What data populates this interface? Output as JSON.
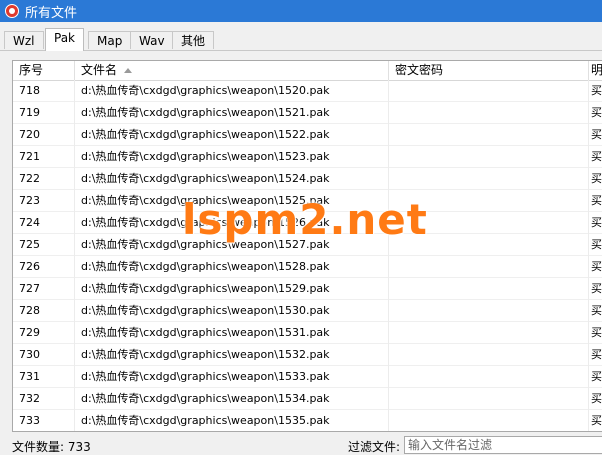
{
  "window": {
    "title": "所有文件",
    "icon": "app-icon"
  },
  "tabs": [
    {
      "label": "Wzl",
      "active": false
    },
    {
      "label": "Pak",
      "active": true
    },
    {
      "label": "Map",
      "active": false
    },
    {
      "label": "Wav",
      "active": false
    },
    {
      "label": "其他",
      "active": false
    }
  ],
  "table": {
    "columns": {
      "seq": "序号",
      "name": "文件名",
      "password": "密文密码",
      "extra": "明"
    },
    "sort": {
      "column": "name",
      "direction": "ascending",
      "icon": "sort-ascending-icon"
    },
    "rows": [
      {
        "seq": "718",
        "name": "d:\\热血传奇\\cxdgd\\graphics\\weapon\\1520.pak",
        "password": "",
        "extra": "买"
      },
      {
        "seq": "719",
        "name": "d:\\热血传奇\\cxdgd\\graphics\\weapon\\1521.pak",
        "password": "",
        "extra": "买"
      },
      {
        "seq": "720",
        "name": "d:\\热血传奇\\cxdgd\\graphics\\weapon\\1522.pak",
        "password": "",
        "extra": "买"
      },
      {
        "seq": "721",
        "name": "d:\\热血传奇\\cxdgd\\graphics\\weapon\\1523.pak",
        "password": "",
        "extra": "买"
      },
      {
        "seq": "722",
        "name": "d:\\热血传奇\\cxdgd\\graphics\\weapon\\1524.pak",
        "password": "",
        "extra": "买"
      },
      {
        "seq": "723",
        "name": "d:\\热血传奇\\cxdgd\\graphics\\weapon\\1525.pak",
        "password": "",
        "extra": "买"
      },
      {
        "seq": "724",
        "name": "d:\\热血传奇\\cxdgd\\graphics\\weapon\\1526.pak",
        "password": "",
        "extra": "买"
      },
      {
        "seq": "725",
        "name": "d:\\热血传奇\\cxdgd\\graphics\\weapon\\1527.pak",
        "password": "",
        "extra": "买"
      },
      {
        "seq": "726",
        "name": "d:\\热血传奇\\cxdgd\\graphics\\weapon\\1528.pak",
        "password": "",
        "extra": "买"
      },
      {
        "seq": "727",
        "name": "d:\\热血传奇\\cxdgd\\graphics\\weapon\\1529.pak",
        "password": "",
        "extra": "买"
      },
      {
        "seq": "728",
        "name": "d:\\热血传奇\\cxdgd\\graphics\\weapon\\1530.pak",
        "password": "",
        "extra": "买"
      },
      {
        "seq": "729",
        "name": "d:\\热血传奇\\cxdgd\\graphics\\weapon\\1531.pak",
        "password": "",
        "extra": "买"
      },
      {
        "seq": "730",
        "name": "d:\\热血传奇\\cxdgd\\graphics\\weapon\\1532.pak",
        "password": "",
        "extra": "买"
      },
      {
        "seq": "731",
        "name": "d:\\热血传奇\\cxdgd\\graphics\\weapon\\1533.pak",
        "password": "",
        "extra": "买"
      },
      {
        "seq": "732",
        "name": "d:\\热血传奇\\cxdgd\\graphics\\weapon\\1534.pak",
        "password": "",
        "extra": "买"
      },
      {
        "seq": "733",
        "name": "d:\\热血传奇\\cxdgd\\graphics\\weapon\\1535.pak",
        "password": "",
        "extra": "买"
      }
    ]
  },
  "status": {
    "count_label": "文件数量: 733",
    "filter_label": "过滤文件:",
    "filter_value": "",
    "filter_placeholder": "输入文件名过滤"
  },
  "watermark": {
    "text": "lspm2.net",
    "color": "#ff7a14"
  }
}
